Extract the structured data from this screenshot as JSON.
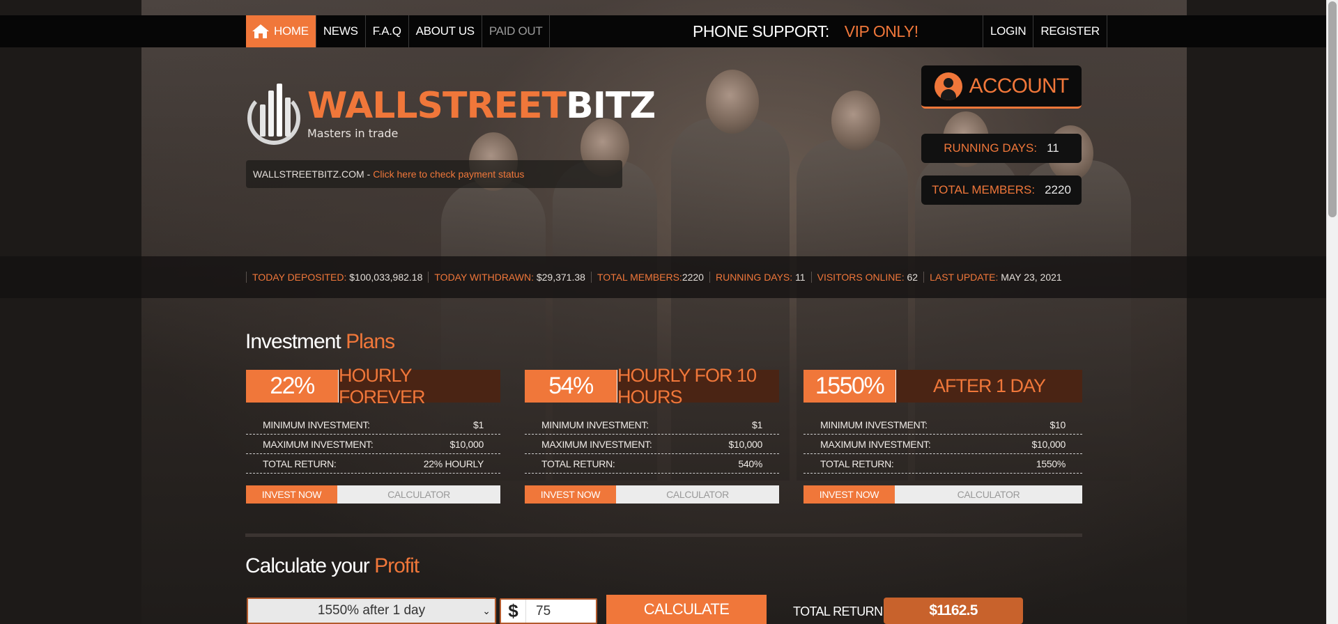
{
  "nav": {
    "home": "Home",
    "news": "News",
    "faq": "F.A.Q",
    "about": "About Us",
    "paid_out": "Paid Out",
    "login": "Login",
    "register": "Register"
  },
  "phone": {
    "label": "PHONE SUPPORT:",
    "value": "VIP ONLY!"
  },
  "logo": {
    "brand_a": "WALLSTREET",
    "brand_b": "BITZ",
    "tagline": "Masters in trade"
  },
  "status_strip": {
    "site": "WALLSTREETBITZ.COM -",
    "link": "Click here to check payment status"
  },
  "account": {
    "label": "ACCOUNT",
    "running_days_label": "RUNNING DAYS:",
    "running_days": "11",
    "total_members_label": "TOTAL MEMBERS:",
    "total_members": "2220"
  },
  "stats": [
    {
      "label": "TODAY DEPOSITED:",
      "value": "$100,033,982.18"
    },
    {
      "label": "TODAY WITHDRAWN:",
      "value": "$29,371.38"
    },
    {
      "label": "TOTAL MEMBERS:",
      "value": "2220"
    },
    {
      "label": "RUNNING DAYS:",
      "value": "11"
    },
    {
      "label": "VISITORS ONLINE:",
      "value": "62"
    },
    {
      "label": "LAST UPDATE:",
      "value": "MAY 23, 2021"
    }
  ],
  "plans_section": {
    "title_a": "Investment",
    "title_b": "Plans"
  },
  "plans": [
    {
      "pct": "22%",
      "name": "HOURLY FOREVER",
      "min_label": "Minimum investment:",
      "min": "$1",
      "max_label": "Maximum investment:",
      "max": "$10,000",
      "ret_label": "Total return:",
      "ret": "22% hourly",
      "invest": "Invest Now",
      "calc": "Calculator"
    },
    {
      "pct": "54%",
      "name": "HOURLY FOR 10 HOURS",
      "min_label": "Minimum investment:",
      "min": "$1",
      "max_label": "Maximum investment:",
      "max": "$10,000",
      "ret_label": "Total return:",
      "ret": "540%",
      "invest": "Invest Now",
      "calc": "Calculator"
    },
    {
      "pct": "1550%",
      "name": "AFTER 1 DAY",
      "min_label": "Minimum investment:",
      "min": "$10",
      "max_label": "Maximum investment:",
      "max": "$10,000",
      "ret_label": "Total return:",
      "ret": "1550%",
      "invest": "Invest Now",
      "calc": "Calculator"
    }
  ],
  "calc_section": {
    "title_a": "Calculate your",
    "title_b": "Profit"
  },
  "calculator": {
    "selected_plan": "1550% after 1 day",
    "currency": "$",
    "amount": "75",
    "button": "Calculate",
    "total_label": "TOTAL RETURN:",
    "total_value": "$1162.5"
  },
  "colors": {
    "accent": "#f0773a",
    "dark": "#060606",
    "plan_name_bg": "#4a2414"
  }
}
